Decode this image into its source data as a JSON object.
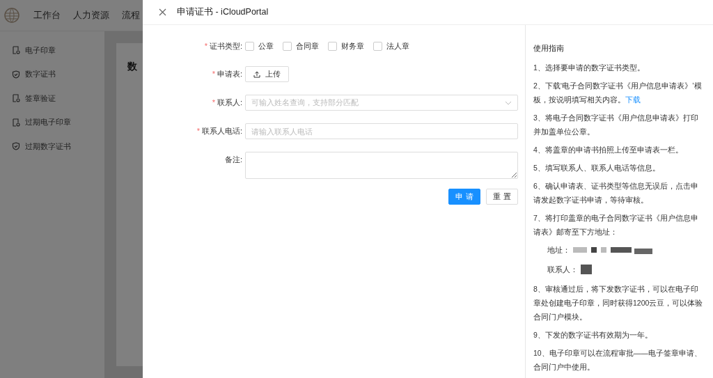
{
  "topnav": {
    "items": [
      "工作台",
      "人力资源",
      "流程"
    ]
  },
  "sidebar": {
    "items": [
      {
        "label": "电子印章",
        "kind": "seal"
      },
      {
        "label": "数字证书",
        "kind": "shield"
      },
      {
        "label": "签章验证",
        "kind": "seal"
      },
      {
        "label": "过期电子印章",
        "kind": "seal"
      },
      {
        "label": "过期数字证书",
        "kind": "shield"
      }
    ]
  },
  "content": {
    "heading": "数"
  },
  "drawer": {
    "title": "申请证书 - iCloudPortal",
    "form": {
      "required_mark": "*",
      "cert_type": {
        "label": "证书类型:",
        "required": true,
        "options": [
          {
            "label": "公章",
            "checked": false
          },
          {
            "label": "合同章",
            "checked": false
          },
          {
            "label": "财务章",
            "checked": false
          },
          {
            "label": "法人章",
            "checked": false
          }
        ]
      },
      "application": {
        "label": "申请表:",
        "required": true,
        "button": "上传"
      },
      "contact": {
        "label": "联系人:",
        "required": true,
        "placeholder": "可输入姓名查询，支持部分匹配"
      },
      "phone": {
        "label": "联系人电话:",
        "required": true,
        "placeholder": "请输入联系人电话"
      },
      "remark": {
        "label": "备注:",
        "required": false
      },
      "buttons": {
        "submit": "申 请",
        "reset": "重 置"
      }
    },
    "guide": {
      "title": "使用指南",
      "steps": [
        {
          "kind": "step",
          "text": "1、选择要申请的数字证书类型。"
        },
        {
          "kind": "step",
          "text": "2、下载‘电子合同数字证书《用户信息申请表》’模板，按说明填写相关内容。",
          "link": "下载"
        },
        {
          "kind": "step",
          "text": "3、将电子合同数字证书《用户信息申请表》打印并加盖单位公章。"
        },
        {
          "kind": "step",
          "text": "4、将盖章的申请书拍照上传至申请表一栏。"
        },
        {
          "kind": "step",
          "text": "5、填写联系人、联系人电话等信息。"
        },
        {
          "kind": "step",
          "text": "6、确认申请表、证书类型等信息无误后，点击申请发起数字证书申请，等待审核。"
        },
        {
          "kind": "step",
          "text": "7、将打印盖章的电子合同数字证书《用户信息申请表》邮寄至下方地址："
        },
        {
          "kind": "address",
          "text": "地址："
        },
        {
          "kind": "contact",
          "text": "联系人："
        },
        {
          "kind": "step",
          "text": "8、审核通过后，将下发数字证书，可以在电子印章处创建电子印章，同时获得1200云豆，可以体验合同门户模块。"
        },
        {
          "kind": "step",
          "text": "9、下发的数字证书有效期为一年。"
        },
        {
          "kind": "step",
          "text": "10、电子印章可以在流程审批——电子签章申请、合同门户中使用。"
        }
      ]
    }
  }
}
